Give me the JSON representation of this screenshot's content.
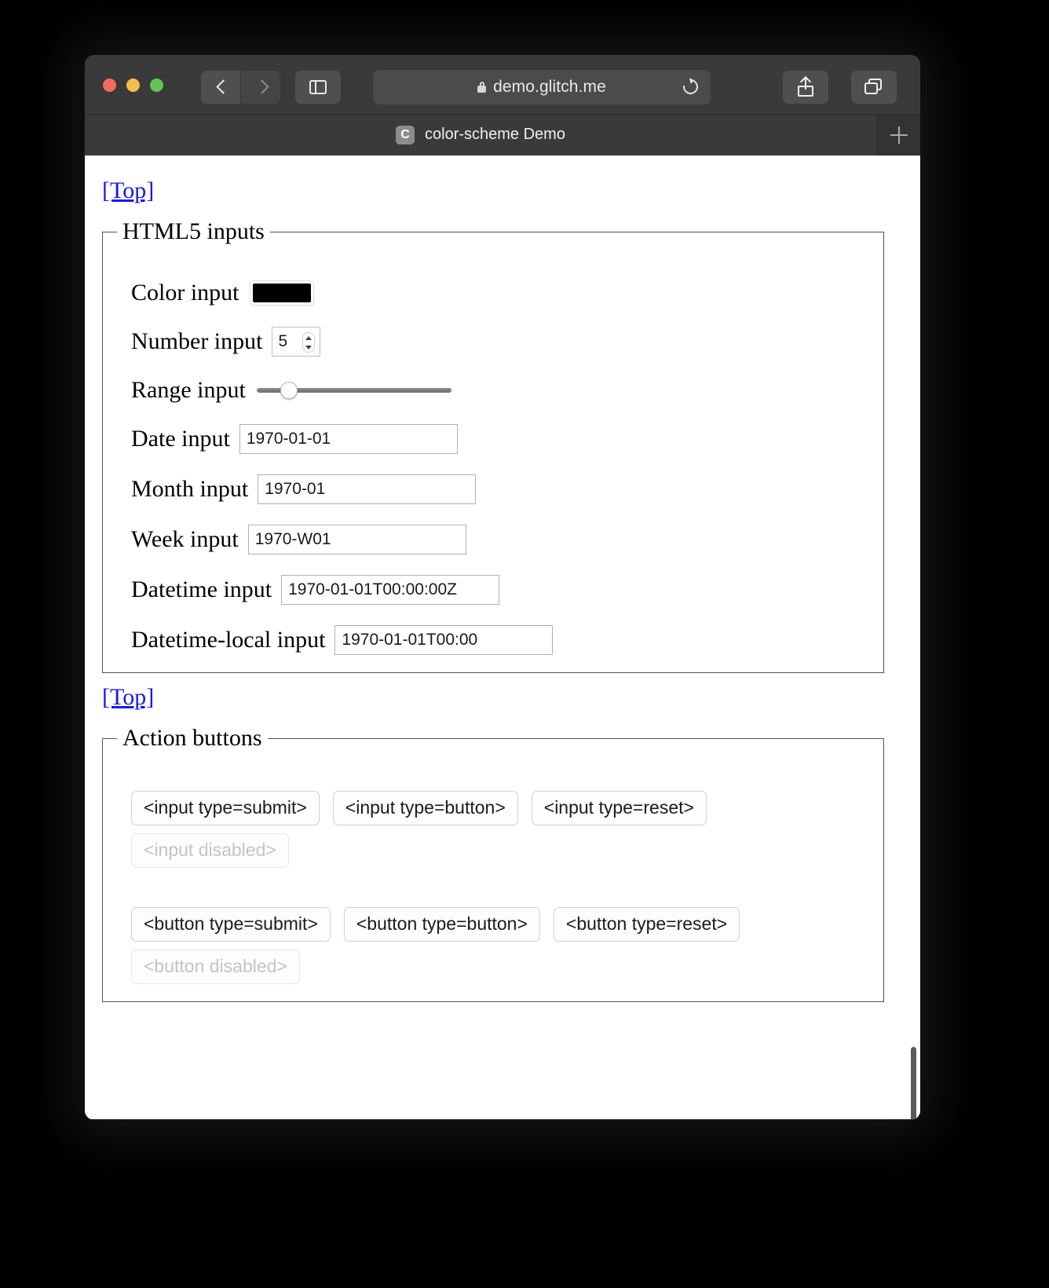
{
  "browser": {
    "window_controls": [
      "close",
      "minimize",
      "maximize"
    ],
    "nav": {
      "back_icon": "chevron-left-icon",
      "forward_icon": "chevron-right-icon"
    },
    "sidebar_icon": "sidebar-toggle-icon",
    "reader_icon": "reader-view-icon",
    "url": "demo.glitch.me",
    "url_lock_icon": "lock-icon",
    "reload_icon": "reload-icon",
    "share_icon": "share-icon",
    "tabs_icon": "show-all-tabs-icon",
    "new_tab_label": "+",
    "tab": {
      "favicon_letter": "C",
      "title": "color-scheme Demo"
    },
    "theme": {
      "chrome_bg": "#3a3a3a",
      "chrome_text": "#f0f0f0",
      "page_bg": "#ffffff"
    }
  },
  "page": {
    "top_link_1": "[Top]",
    "top_link_2": "[Top]",
    "link_color": "#1818ee",
    "html5_inputs": {
      "legend": "HTML5 inputs",
      "fields": [
        {
          "label": "Color input",
          "type": "color",
          "value": "#000000"
        },
        {
          "label": "Number input",
          "type": "number",
          "value": "5"
        },
        {
          "label": "Range input",
          "type": "range",
          "value": "13",
          "min": "0",
          "max": "100"
        },
        {
          "label": "Date input",
          "type": "date",
          "value": "1970-01-01"
        },
        {
          "label": "Month input",
          "type": "month",
          "value": "1970-01"
        },
        {
          "label": "Week input",
          "type": "week",
          "value": "1970-W01"
        },
        {
          "label": "Datetime input",
          "type": "datetime",
          "value": "1970-01-01T00:00:00Z"
        },
        {
          "label": "Datetime-local input",
          "type": "datetime-local",
          "value": "1970-01-01T00:00"
        }
      ]
    },
    "action_buttons": {
      "legend": "Action buttons",
      "input_row": [
        "<input type=submit>",
        "<input type=button>",
        "<input type=reset>"
      ],
      "input_disabled": "<input disabled>",
      "button_row": [
        "<button type=submit>",
        "<button type=button>",
        "<button type=reset>"
      ],
      "button_disabled": "<button disabled>"
    }
  }
}
